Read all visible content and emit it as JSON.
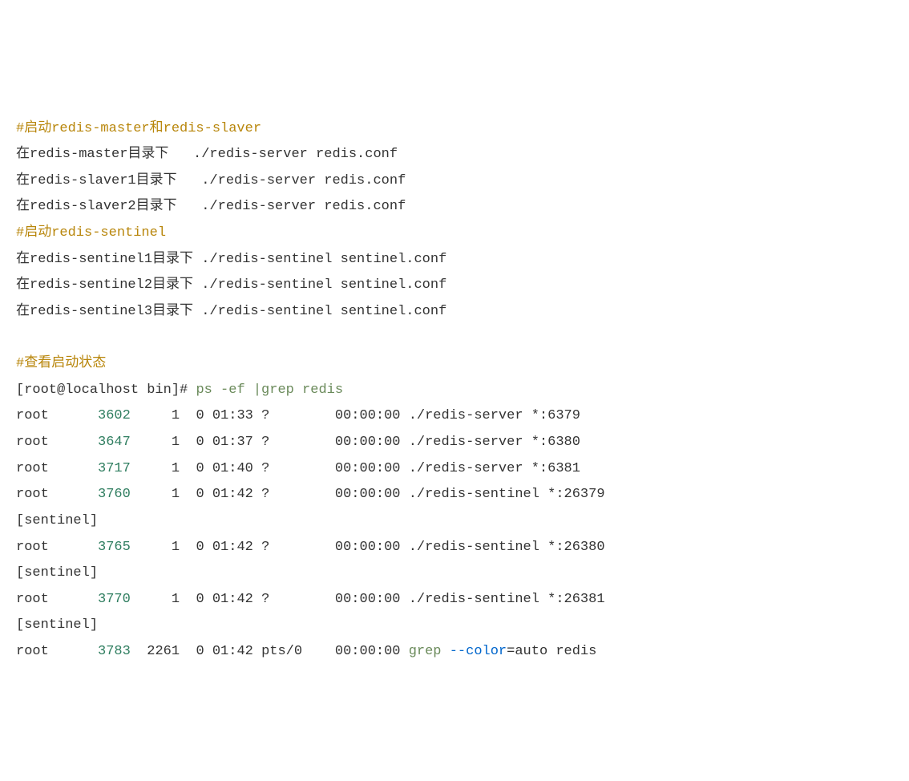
{
  "lines": {
    "comment1": "#启动redis-master和redis-slaver",
    "l1": "在redis-master目录下   ./redis-server redis.conf",
    "l2": "在redis-slaver1目录下   ./redis-server redis.conf",
    "l3": "在redis-slaver2目录下   ./redis-server redis.conf",
    "comment2": "#启动redis-sentinel",
    "l4": "在redis-sentinel1目录下 ./redis-sentinel sentinel.conf",
    "l5": "在redis-sentinel2目录下 ./redis-sentinel sentinel.conf",
    "l6": "在redis-sentinel3目录下 ./redis-sentinel sentinel.conf",
    "comment3": "#查看启动状态",
    "prompt": "[root@localhost bin]# ",
    "cmd": "ps -ef |grep redis",
    "r1a": "root      ",
    "r1pid": "3602",
    "r1b": "     1  0 01:33 ?        00:00:00 ./redis-server *:6379",
    "r2a": "root      ",
    "r2pid": "3647",
    "r2b": "     1  0 01:37 ?        00:00:00 ./redis-server *:6380",
    "r3a": "root      ",
    "r3pid": "3717",
    "r3b": "     1  0 01:40 ?        00:00:00 ./redis-server *:6381",
    "r4a": "root      ",
    "r4pid": "3760",
    "r4b": "     1  0 01:42 ?        00:00:00 ./redis-sentinel *:26379 ",
    "sentinel": "[sentinel]",
    "r5a": "root      ",
    "r5pid": "3765",
    "r5b": "     1  0 01:42 ?        00:00:00 ./redis-sentinel *:26380 ",
    "r6a": "root      ",
    "r6pid": "3770",
    "r6b": "     1  0 01:42 ?        00:00:00 ./redis-sentinel *:26381 ",
    "r7a": "root      ",
    "r7pid": "3783",
    "r7b": "  2261  0 01:42 pts/0    00:00:00 ",
    "grep": "grep",
    "space": " ",
    "colorflag": "--color",
    "rest": "=auto redis"
  }
}
